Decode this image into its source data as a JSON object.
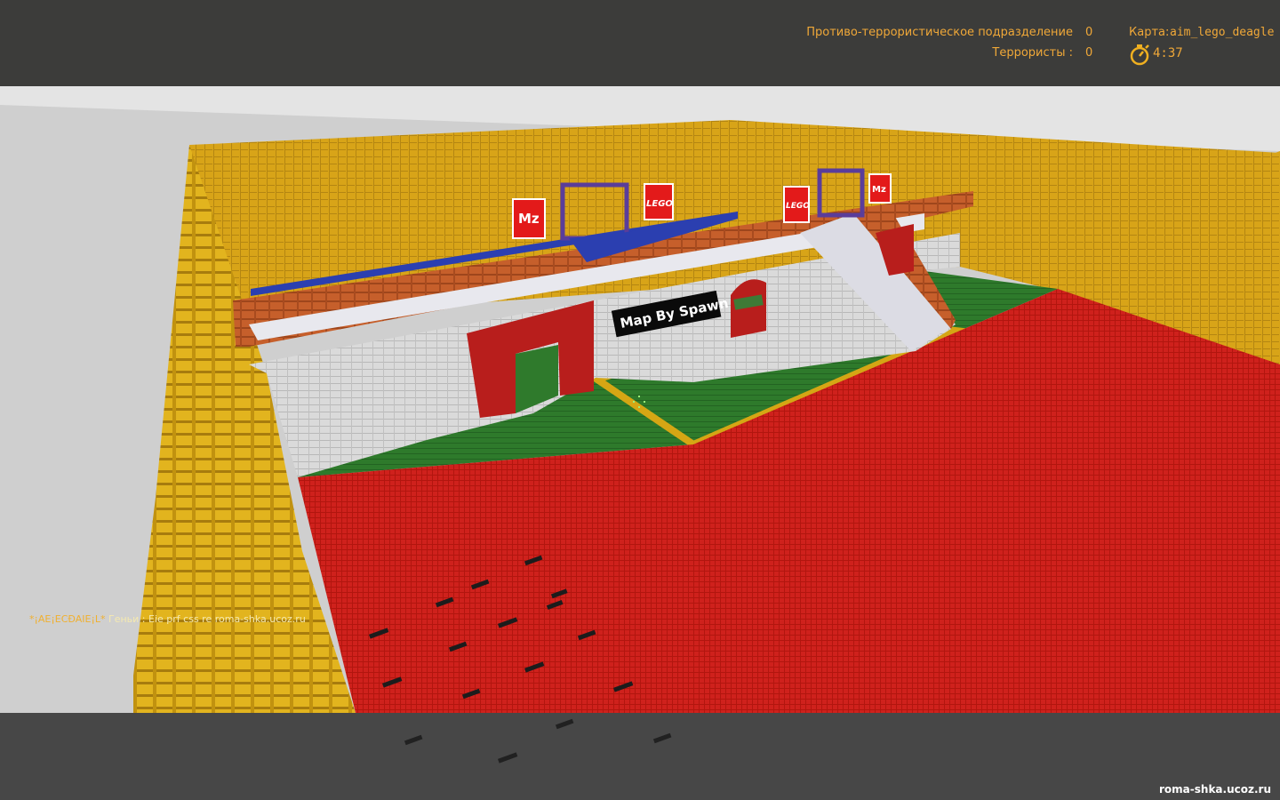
{
  "hud": {
    "ct_team_label": "Противо-террористическое подразделение",
    "ct_score": "0",
    "t_team_label": "Террористы :",
    "t_score": "0",
    "map_label": "Карта:",
    "map_name": "aim_lego_deagle",
    "timer": "4:37",
    "timer_icon": "stopwatch-icon"
  },
  "chat": {
    "player_name": "*¡AE¡ECÐAIE¡L*",
    "message": "Геньи :  Eie prf css re",
    "url": "roma-shka.ucoz.ru"
  },
  "scene": {
    "sign_text": "Map By Spawn",
    "logos": [
      "Mz",
      "LEGO",
      "LEGO",
      "Mz"
    ]
  },
  "watermark": "roma-shka.ucoz.ru",
  "colors": {
    "hud_text": "#f0a838",
    "wall_yellow": "#d6a21a",
    "floor_red": "#cc1f1a",
    "floor_green": "#2f7a2c",
    "brick_orange": "#c8602c",
    "wall_white": "#dcdcdc"
  }
}
